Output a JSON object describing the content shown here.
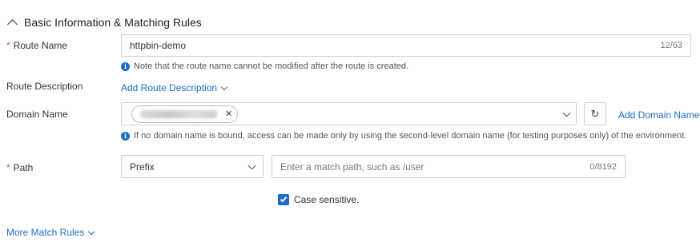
{
  "section": {
    "title": "Basic Information & Matching Rules"
  },
  "route_name": {
    "label": "Route Name",
    "required_mark": "*",
    "value": "httpbin-demo",
    "counter": "12/63",
    "hint": "Note that the route name cannot be modified after the route is created."
  },
  "route_description": {
    "label": "Route Description",
    "link": "Add Route Description"
  },
  "domain_name": {
    "label": "Domain Name",
    "add_link": "Add Domain Name",
    "hint": "If no domain name is bound, access can be made only by using the second-level domain name (for testing purposes only) of the environment.",
    "tag_close": "✕"
  },
  "path": {
    "label": "Path",
    "required_mark": "*",
    "match_type": "Prefix",
    "placeholder": "Enter a match path, such as /user",
    "counter": "0/8192"
  },
  "case_sensitive": {
    "label": "Case sensitive.",
    "checked": true
  },
  "more_rules": {
    "link": "More Match Rules"
  },
  "icons": {
    "info": "i",
    "refresh": "↻"
  },
  "colors": {
    "accent": "#1a6dca",
    "required": "#e34d4d"
  }
}
